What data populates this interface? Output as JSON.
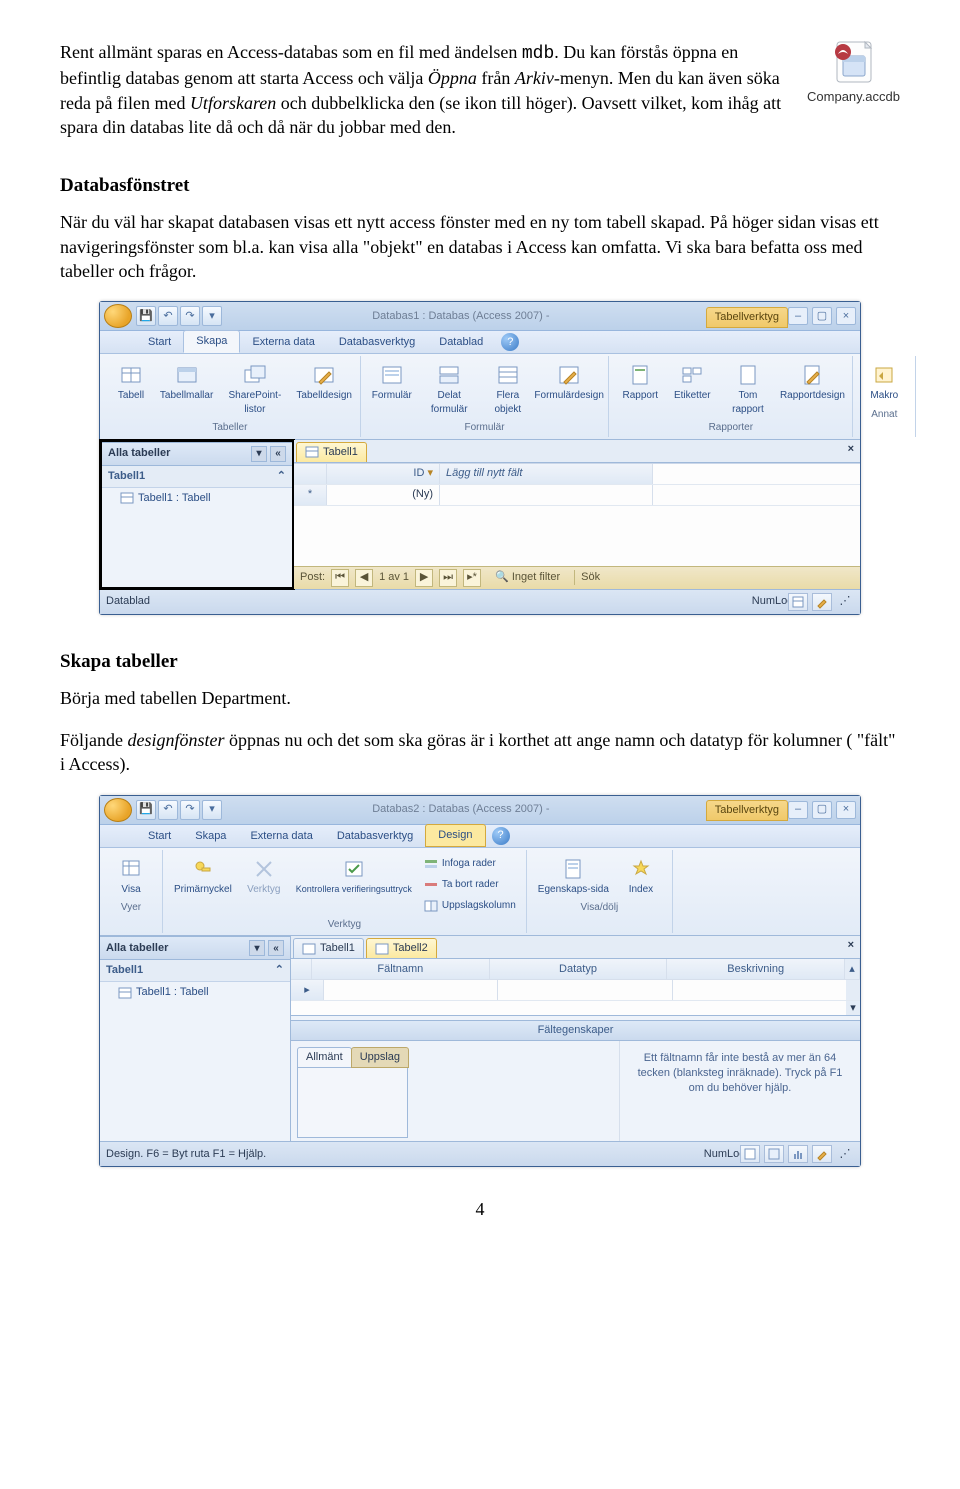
{
  "fileIcon": {
    "label": "Company.accdb"
  },
  "para1": {
    "a": "Rent allmänt sparas en Access-databas som en fil med ändelsen ",
    "mdb": "mdb",
    "b": ". Du kan förstås öppna en befintlig databas genom att starta Access och välja ",
    "oppna": "Öppna",
    "c": " från ",
    "arkiv": "Arkiv",
    "d": "-menyn. Men du kan även söka reda på filen med ",
    "utf": "Utforskaren",
    "e": " och dubbelklicka den (se ikon till höger). Oavsett vilket, kom ihåg att spara din databas lite då och då när du jobbar med den."
  },
  "h1": "Databasfönstret",
  "para2": "När du väl har skapat databasen visas ett nytt access fönster med en ny tom tabell skapad. På höger sidan visas ett navigeringsfönster som bl.a. kan visa alla \"objekt\" en databas i Access kan omfatta. Vi ska bara befatta oss med tabeller och frågor.",
  "win1": {
    "title": "Databas1 : Databas (Access 2007) -",
    "toolTab": "Tabellverktyg",
    "tabs": [
      "Start",
      "Skapa",
      "Externa data",
      "Databasverktyg",
      "Datablad"
    ],
    "activeTab": 1,
    "ribbon": {
      "g1": {
        "btns": [
          "Tabell",
          "Tabellmallar",
          "SharePoint-listor",
          "Tabelldesign"
        ],
        "label": "Tabeller"
      },
      "g2": {
        "btns": [
          "Formulär",
          "Delat formulär",
          "Flera objekt",
          "Formulärdesign"
        ],
        "label": "Formulär"
      },
      "g3": {
        "btns": [
          "Rapport",
          "Etiketter",
          "Tom rapport",
          "Rapportdesign"
        ],
        "label": "Rapporter"
      },
      "g4": {
        "btns": [
          "Makro"
        ],
        "label": "Annat"
      }
    },
    "nav": {
      "header": "Alla tabeller",
      "group": "Tabell1",
      "item": "Tabell1 : Tabell"
    },
    "docTab": "Tabell1",
    "cols": {
      "id": "ID",
      "add": "Lägg till nytt fält"
    },
    "row": {
      "ny": "(Ny)"
    },
    "recNav": {
      "label": "Post:",
      "pos": "1 av 1",
      "filter": "Inget filter",
      "search": "Sök"
    },
    "status": {
      "left": "Datablad",
      "num": "NumLock"
    }
  },
  "h2": "Skapa tabeller",
  "para3a": "Börja med tabellen Department.",
  "para3b_a": "Följande ",
  "para3b_i": "designfönster",
  "para3b_b": " öppnas nu och det som ska göras är i korthet att ange namn och datatyp för kolumner ( \"fält\" i Access).",
  "win2": {
    "title": "Databas2 : Databas (Access 2007) -",
    "toolTab": "Tabellverktyg",
    "tabs": [
      "Start",
      "Skapa",
      "Externa data",
      "Databasverktyg",
      "Design"
    ],
    "activeTab": 4,
    "ribbon": {
      "g1": {
        "btns": [
          "Visa"
        ],
        "label": "Vyer"
      },
      "g2": {
        "btns": [
          "Primärnyckel",
          "Verktyg",
          "Kontrollera verifieringsuttryck"
        ],
        "small": [
          "Infoga rader",
          "Ta bort rader",
          "Uppslagskolumn"
        ],
        "label": "Verktyg"
      },
      "g3": {
        "btns": [
          "Egenskaps-sida",
          "Index"
        ],
        "label": "Visa/dölj"
      }
    },
    "nav": {
      "header": "Alla tabeller",
      "group": "Tabell1",
      "item": "Tabell1 : Tabell"
    },
    "docTabs": [
      "Tabell1",
      "Tabell2"
    ],
    "designCols": [
      "Fältnamn",
      "Datatyp",
      "Beskrivning"
    ],
    "props": {
      "title": "Fältegenskaper",
      "tabs": [
        "Allmänt",
        "Uppslag"
      ],
      "hint": "Ett fältnamn får inte bestå av mer än 64 tecken (blanksteg inräknade). Tryck på F1 om du behöver hjälp."
    },
    "status": {
      "left": "Design. F6 = Byt ruta F1 = Hjälp.",
      "num": "NumLock"
    }
  },
  "pageNum": "4"
}
